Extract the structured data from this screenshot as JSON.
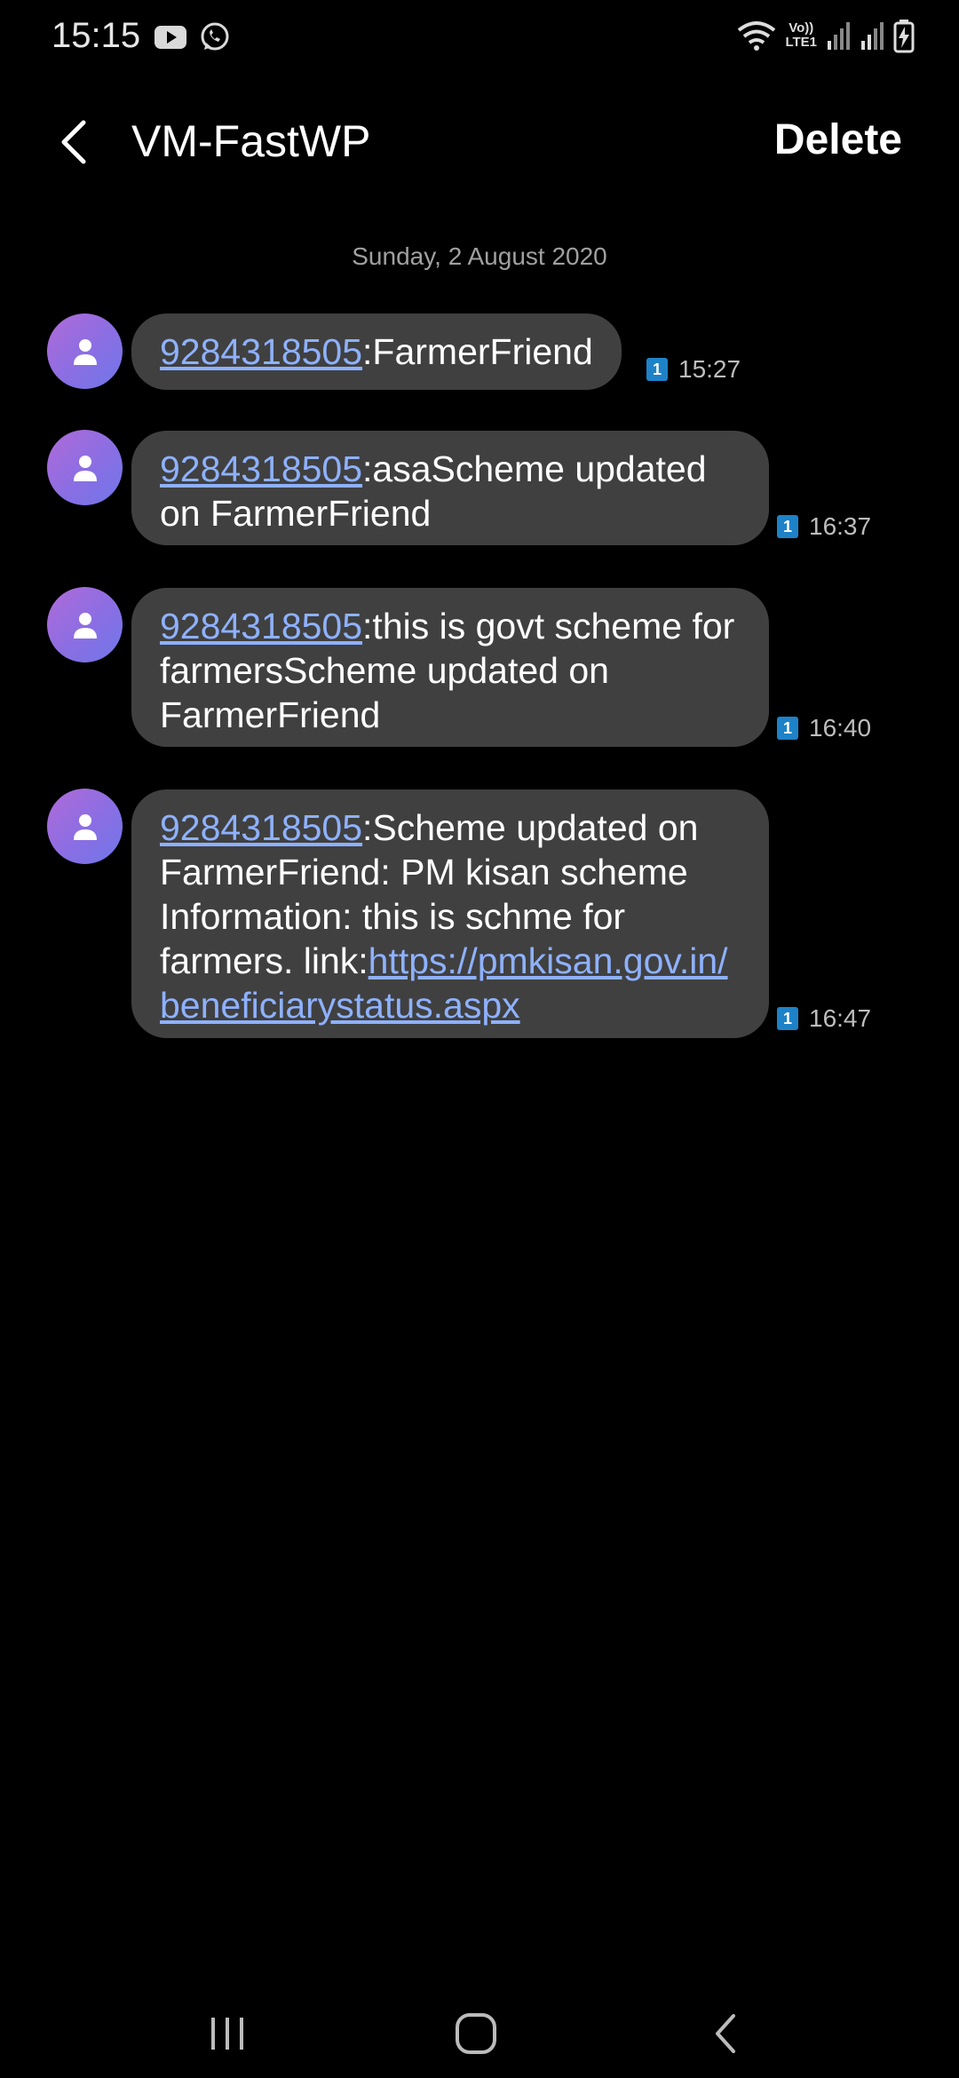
{
  "status": {
    "time": "15:15",
    "volte_top": "Vo))",
    "volte_bottom": "LTE1"
  },
  "header": {
    "title": "VM-FastWP",
    "delete_label": "Delete"
  },
  "date_separator": "Sunday, 2 August 2020",
  "messages": [
    {
      "number": "9284318505",
      "text": ":FarmerFriend",
      "sim": "1",
      "time": "15:27"
    },
    {
      "number": "9284318505",
      "text": ":asaScheme updated on FarmerFriend",
      "sim": "1",
      "time": "16:37"
    },
    {
      "number": "9284318505",
      "text": ":this is govt scheme for farmersScheme updated on FarmerFriend",
      "sim": "1",
      "time": "16:40"
    },
    {
      "number": "9284318505",
      "text": ":Scheme updated on FarmerFriend:  PM kisan scheme Information:  this is schme for farmers. link:",
      "link": "https://pmkisan.gov.in/beneficiarystatus.aspx",
      "sim": "1",
      "time": "16:47"
    }
  ],
  "colors": {
    "background": "#000000",
    "bubble": "#404040",
    "link": "#8eb1ff",
    "sim_badge": "#1e82c8"
  }
}
